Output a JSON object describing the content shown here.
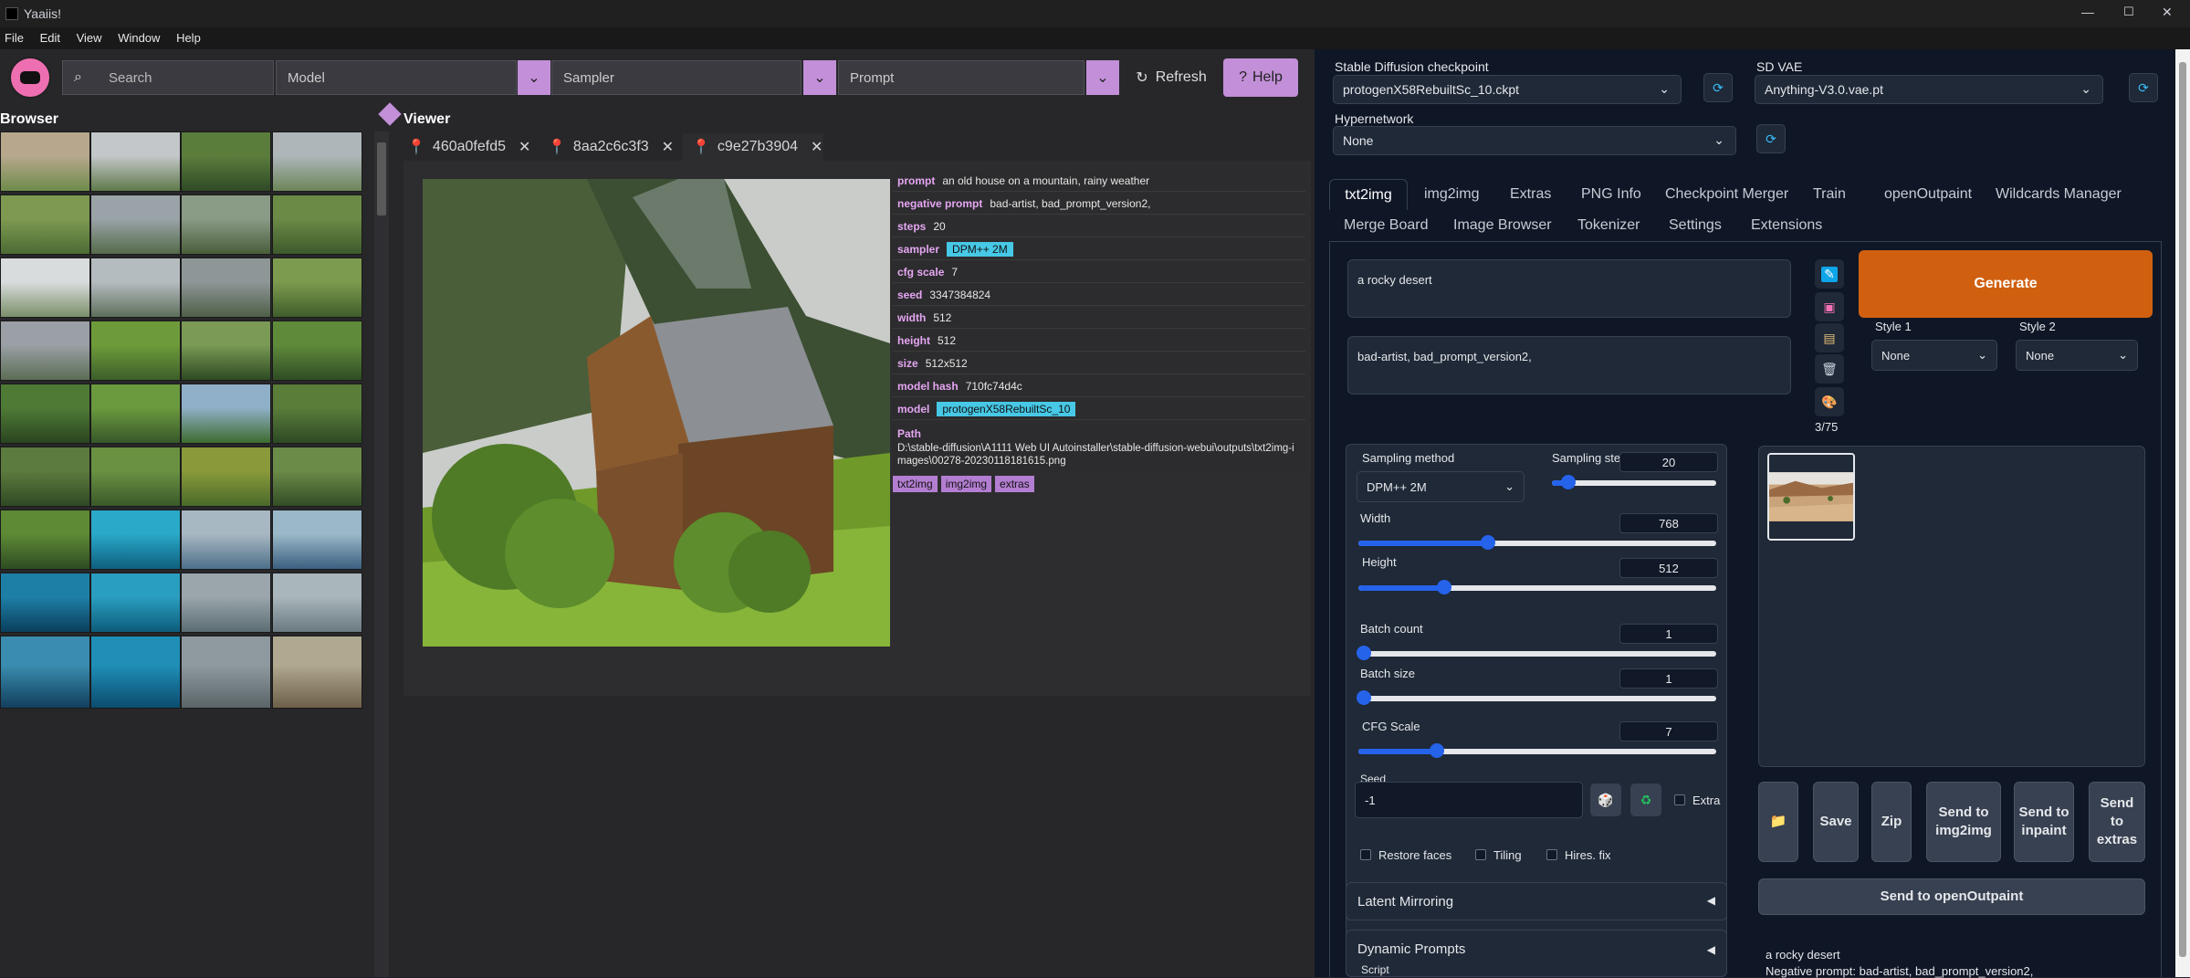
{
  "window": {
    "title": "Yaaiis!",
    "controls": [
      "—",
      "☐",
      "✕"
    ]
  },
  "menu": [
    "File",
    "Edit",
    "View",
    "Window",
    "Help"
  ],
  "toolbar": {
    "search_placeholder": "Search",
    "model_label": "Model",
    "sampler_label": "Sampler",
    "prompt_label": "Prompt",
    "refresh_label": "Refresh",
    "help_label": "Help"
  },
  "browser": {
    "title": "Browser"
  },
  "viewer": {
    "title": "Viewer",
    "tabs": [
      "460a0fefd5",
      "8aa2c6c3f3",
      "c9e27b3904"
    ],
    "info": [
      {
        "key": "prompt",
        "value": "an old house on a mountain, rainy weather"
      },
      {
        "key": "negative prompt",
        "value": "bad-artist, bad_prompt_version2,"
      },
      {
        "key": "steps",
        "value": "20"
      },
      {
        "key": "sampler",
        "value": "DPM++ 2M"
      },
      {
        "key": "cfg scale",
        "value": "7"
      },
      {
        "key": "seed",
        "value": "3347384824"
      },
      {
        "key": "width",
        "value": "512"
      },
      {
        "key": "height",
        "value": "512"
      },
      {
        "key": "size",
        "value": "512x512"
      },
      {
        "key": "model hash",
        "value": "710fc74d4c"
      },
      {
        "key": "model",
        "value": "protogenX58RebuiltSc_10"
      }
    ],
    "path_label": "Path",
    "path_value": "D:\\stable-diffusion\\A1111 Web UI Autoinstaller\\stable-diffusion-webui\\outputs\\txt2img-images\\00278-20230118181615.png",
    "send_buttons": [
      "txt2img",
      "img2img",
      "extras"
    ]
  },
  "sd": {
    "checkpoint_label": "Stable Diffusion checkpoint",
    "checkpoint_value": "protogenX58RebuiltSc_10.ckpt",
    "vae_label": "SD VAE",
    "vae_value": "Anything-V3.0.vae.pt",
    "hypernetwork_label": "Hypernetwork",
    "hypernetwork_value": "None",
    "tabs_row1": [
      "txt2img",
      "img2img",
      "Extras",
      "PNG Info",
      "Checkpoint Merger",
      "Train",
      "openOutpaint",
      "Wildcards Manager"
    ],
    "tabs_row2": [
      "Merge Board",
      "Image Browser",
      "Tokenizer",
      "Settings",
      "Extensions"
    ],
    "prompt": "a rocky desert",
    "negative_prompt": "bad-artist, bad_prompt_version2,",
    "token_count": "3/75",
    "generate": "Generate",
    "style1_label": "Style 1",
    "style1_value": "None",
    "style2_label": "Style 2",
    "style2_value": "None",
    "sampling_method_label": "Sampling method",
    "sampling_method_value": "DPM++ 2M",
    "sampling_steps_label": "Sampling ste",
    "sampling_steps_value": "20",
    "width_label": "Width",
    "width_value": "768",
    "height_label": "Height",
    "height_value": "512",
    "batch_count_label": "Batch count",
    "batch_count_value": "1",
    "batch_size_label": "Batch size",
    "batch_size_value": "1",
    "cfg_label": "CFG Scale",
    "cfg_value": "7",
    "seed_label": "Seed",
    "seed_value": "-1",
    "extra_label": "Extra",
    "restore_faces": "Restore faces",
    "tiling": "Tiling",
    "hires_fix": "Hires. fix",
    "latent_mirroring": "Latent Mirroring",
    "dynamic_prompts": "Dynamic Prompts",
    "script_label": "Script",
    "output_buttons": {
      "save": "Save",
      "zip": "Zip",
      "send_img2img": "Send to img2img",
      "send_inpaint": "Send to inpaint",
      "send_extras": "Send to extras"
    },
    "send_openoutpaint": "Send to openOutpaint",
    "output_prompt": "a rocky desert",
    "output_negative": "Negative prompt: bad-artist, bad_prompt_version2,"
  },
  "colors": {
    "accent_pink": "#c28fd8",
    "generate_orange": "#d06010",
    "chip_cyan": "#47c8e6",
    "slider_blue": "#2563eb"
  }
}
